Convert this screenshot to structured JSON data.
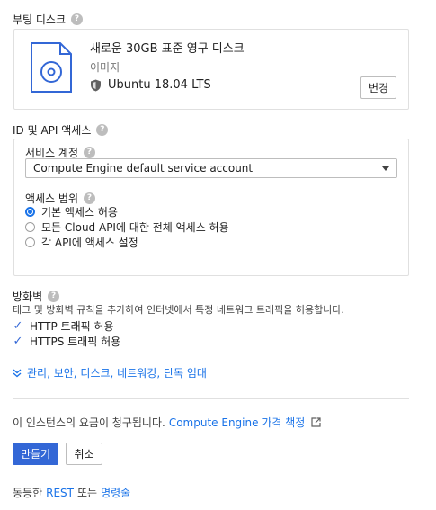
{
  "boot_disk": {
    "title": "부팅 디스크",
    "disk_title": "새로운 30GB 표준 영구 디스크",
    "image_label": "이미지",
    "os": "Ubuntu 18.04 LTS",
    "change_label": "변경"
  },
  "identity": {
    "title": "ID 및 API 액세스",
    "service_account_label": "서비스 계정",
    "service_account_value": "Compute Engine default service account",
    "access_scope_label": "액세스 범위",
    "scopes": [
      {
        "label": "기본 액세스 허용",
        "selected": true
      },
      {
        "label": "모든 Cloud API에 대한 전체 액세스 허용",
        "selected": false
      },
      {
        "label": "각 API에 액세스 설정",
        "selected": false
      }
    ]
  },
  "firewall": {
    "title": "방화벽",
    "description": "태그 및 방화벽 규칙을 추가하여 인터넷에서 특정 네트워크 트래픽을 허용합니다.",
    "http_label": "HTTP 트래픽 허용",
    "https_label": "HTTPS 트래픽 허용",
    "http_checked": true,
    "https_checked": true
  },
  "advanced_link": "관리, 보안, 디스크, 네트워킹, 단독 임대",
  "billing": {
    "text": "이 인스턴스의 요금이 청구됩니다.",
    "link": "Compute Engine 가격 책정"
  },
  "actions": {
    "create": "만들기",
    "cancel": "취소"
  },
  "footer": {
    "prefix": "동등한",
    "rest": "REST",
    "middle": "또는",
    "cli": "명령줄"
  },
  "colors": {
    "primary": "#3367d6",
    "link": "#1a73e8"
  }
}
